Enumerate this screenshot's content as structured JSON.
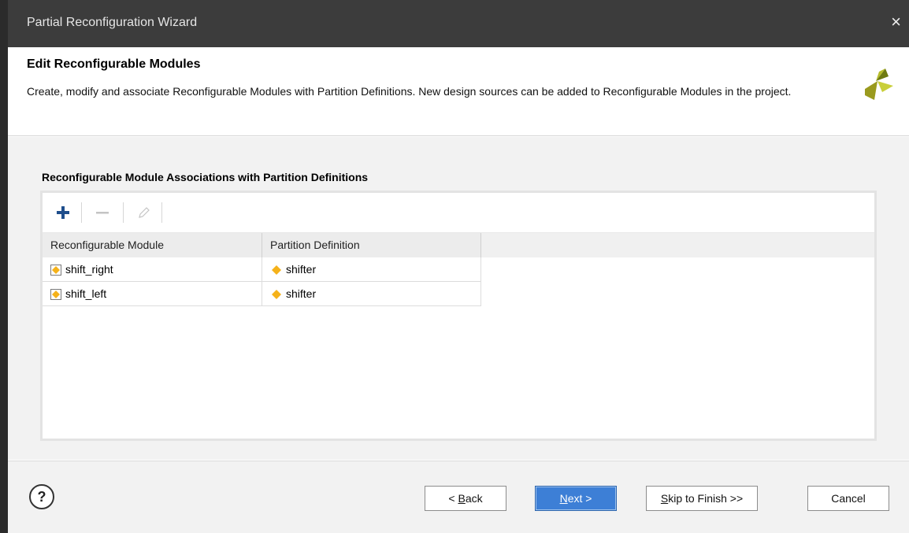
{
  "window": {
    "title": "Partial Reconfiguration Wizard",
    "close_glyph": "×"
  },
  "header": {
    "title": "Edit Reconfigurable Modules",
    "description": "Create, modify and associate Reconfigurable Modules with Partition Definitions. New design sources can be added to Reconfigurable Modules in the project.",
    "logo_icon": "xilinx-logo-icon"
  },
  "section": {
    "label": "Reconfigurable Module Associations with Partition Definitions"
  },
  "toolbar": {
    "add_icon": "plus-icon",
    "remove_icon": "minus-icon",
    "edit_icon": "pencil-icon",
    "accent": "#1f4e8c"
  },
  "table": {
    "columns": [
      "Reconfigurable Module",
      "Partition Definition"
    ],
    "rows": [
      {
        "module": "shift_right",
        "partition": "shifter"
      },
      {
        "module": "shift_left",
        "partition": "shifter"
      }
    ]
  },
  "footer": {
    "help_glyph": "?",
    "back": {
      "prefix": "< ",
      "mnemonic": "B",
      "rest": "ack"
    },
    "next": {
      "mnemonic": "N",
      "rest": "ext >"
    },
    "skip": {
      "mnemonic": "S",
      "rest": "kip to Finish >>"
    },
    "cancel": "Cancel"
  },
  "colors": {
    "titlebar": "#3c3c3c",
    "primary_button": "#3d7fd6",
    "diamond": "#f5b21a"
  }
}
